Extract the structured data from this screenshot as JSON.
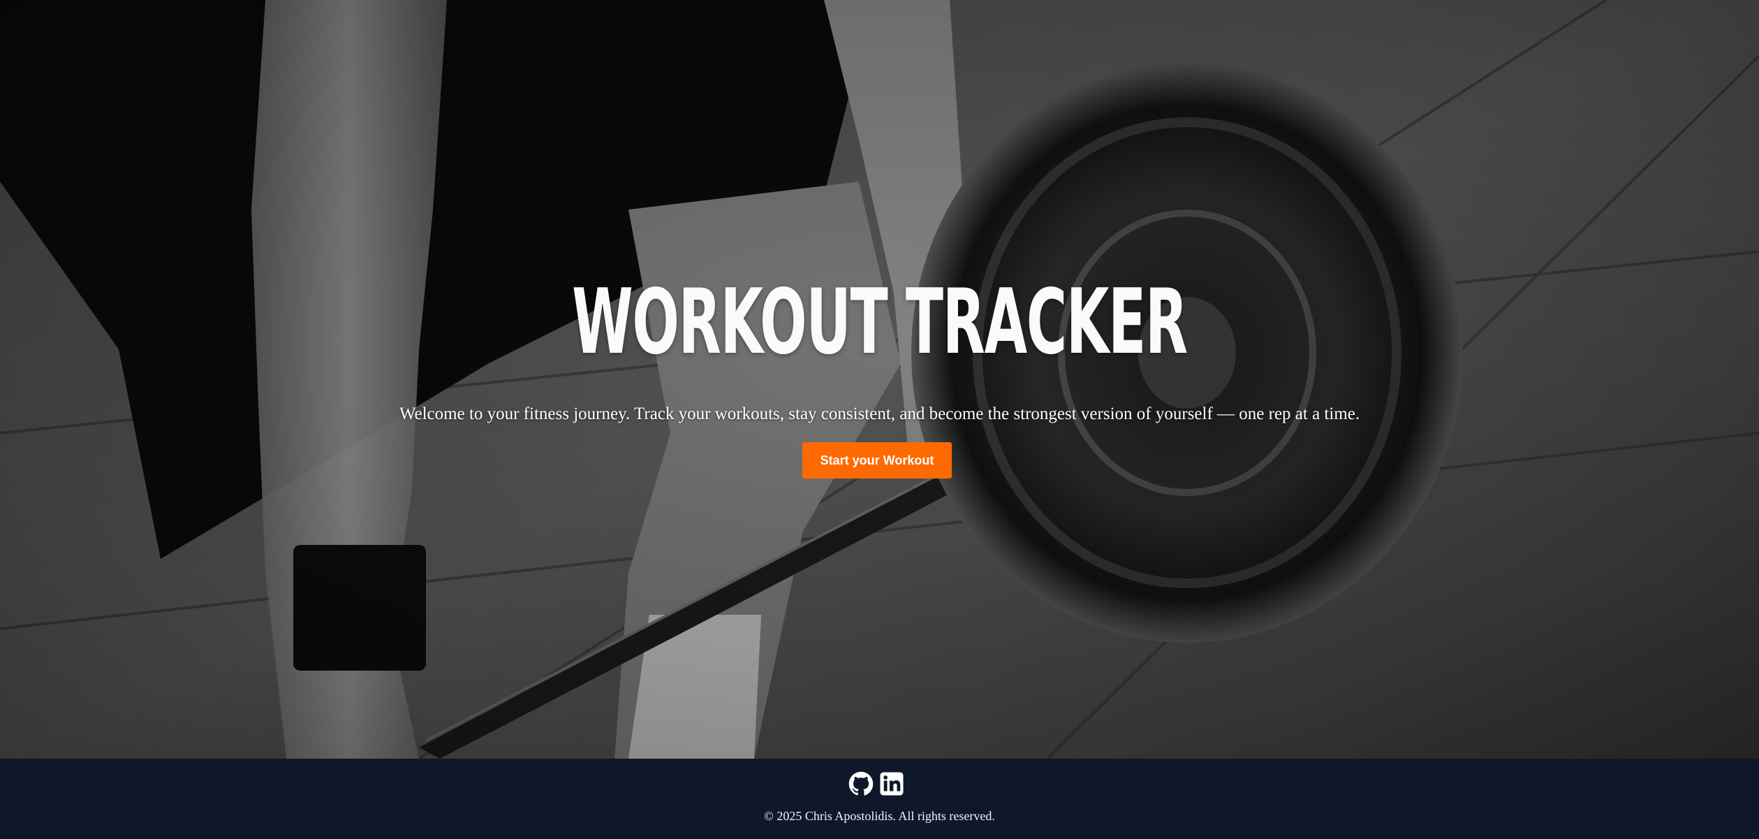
{
  "hero": {
    "title": "WORKOUT TRACKER",
    "subtitle": "Welcome to your fitness journey. Track your workouts, stay consistent, and become the strongest version of yourself — one rep at a time.",
    "cta_label": "Start your Workout",
    "background_image": "athlete-deadlift-barbell-photo"
  },
  "footer": {
    "social": [
      {
        "icon": "github-icon"
      },
      {
        "icon": "linkedin-icon"
      }
    ],
    "copyright": "© 2025 Chris Apostolidis. All rights reserved."
  },
  "colors": {
    "accent": "#ff6a00",
    "footer_bg": "#0f172a",
    "title": "#f8fafc",
    "text": "#ffffff"
  }
}
